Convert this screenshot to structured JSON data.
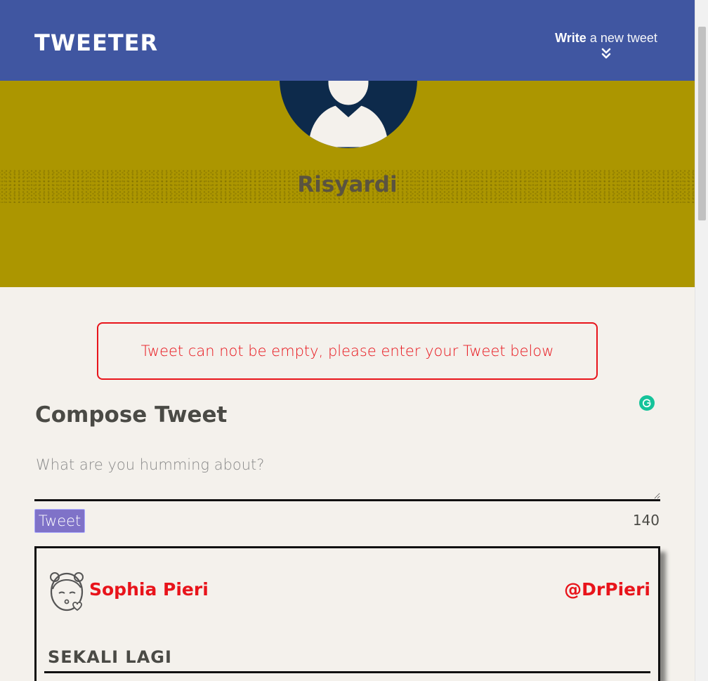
{
  "nav": {
    "logo": "TWEETER",
    "write_strong": "Write",
    "write_rest": " a new tweet"
  },
  "profile": {
    "name": "Risyardi"
  },
  "error": {
    "message": "Tweet can not be empty, please enter your Tweet below"
  },
  "compose": {
    "title": "Compose Tweet",
    "placeholder": "What are you humming about?",
    "button_label": "Tweet",
    "counter": "140"
  },
  "tweet": {
    "name": "Sophia Pieri",
    "handle": "@DrPieri",
    "content": "Sekali lagi",
    "avatar_icon": "girl-avatar-icon"
  },
  "colors": {
    "nav": "#4056a1",
    "header": "#ac9600",
    "error": "#e8141b",
    "button": "#7f72c8",
    "grammarly": "#15c39a"
  }
}
